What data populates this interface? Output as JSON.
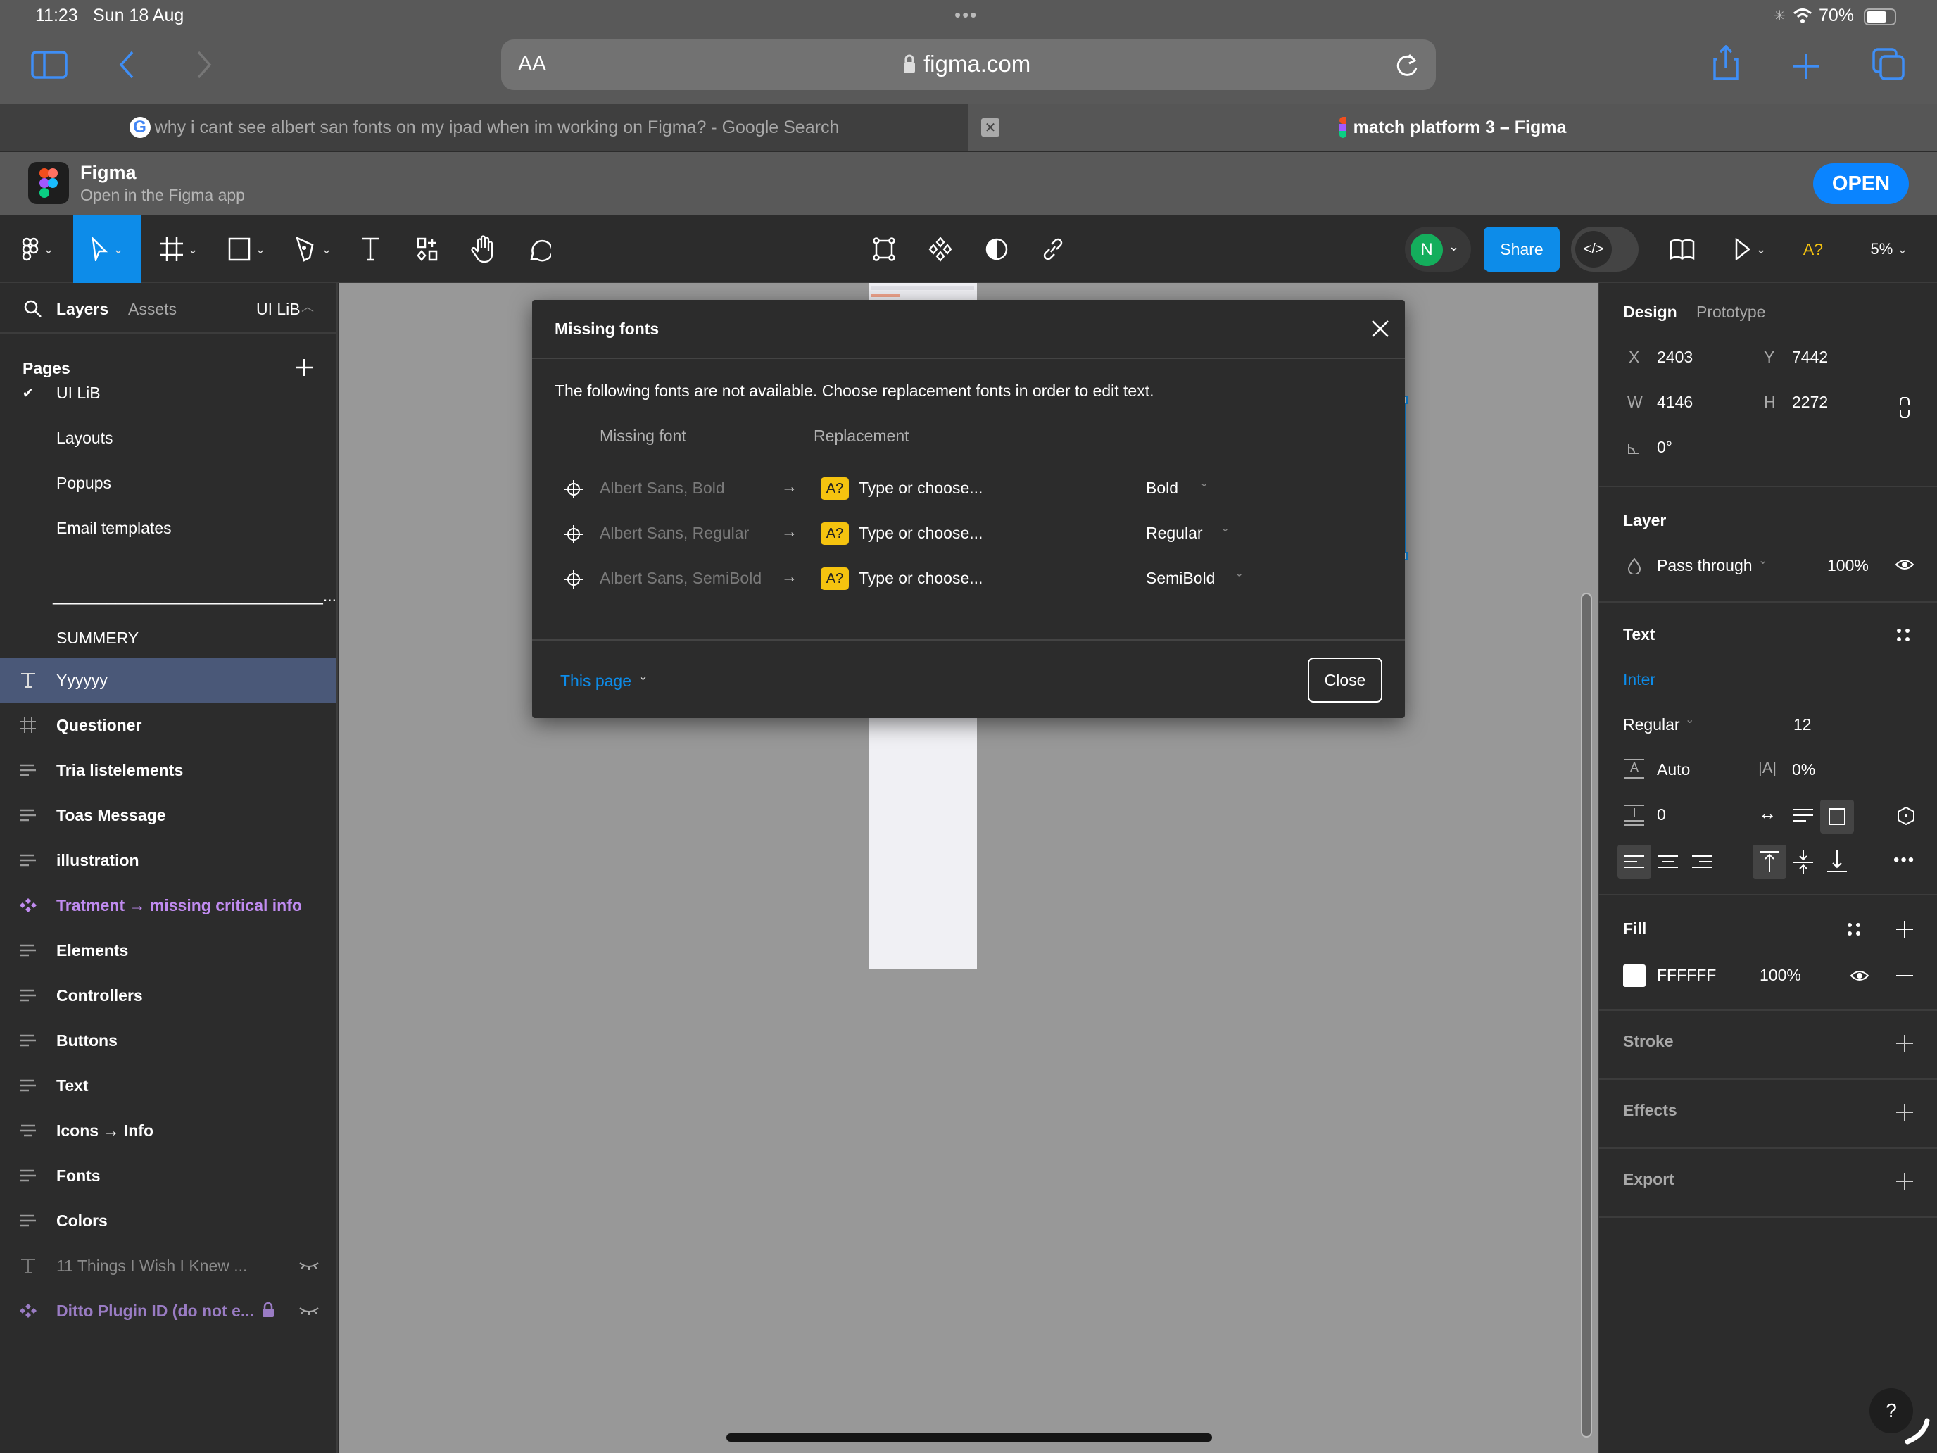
{
  "status_bar": {
    "time": "11:23",
    "date": "Sun 18 Aug",
    "battery": "70%"
  },
  "safari": {
    "reader_label": "AA",
    "url": "figma.com",
    "tabs": [
      {
        "title": "why i cant see albert san fonts on my ipad when im working on Figma? - Google Search",
        "active": false
      },
      {
        "title": "match platform 3 – Figma",
        "active": true
      }
    ],
    "banner": {
      "app_name": "Figma",
      "subtitle": "Open in the Figma app",
      "open_label": "OPEN"
    }
  },
  "toolbar": {
    "avatar_initial": "N",
    "share_label": "Share",
    "code_label": "</>",
    "missing_font_label": "A?",
    "zoom_level": "5%"
  },
  "left_panel": {
    "tabs": {
      "layers": "Layers",
      "assets": "Assets",
      "page_selector": "UI LiB"
    },
    "pages_heading": "Pages",
    "pages": [
      {
        "label": "UI LiB",
        "current": true
      },
      {
        "label": "Layouts"
      },
      {
        "label": "Popups"
      },
      {
        "label": "Email templates"
      },
      {
        "label": "______________________________..."
      },
      {
        "label": "SUMMERY"
      }
    ],
    "layers": [
      {
        "label": "Yyyyyy",
        "icon": "text",
        "selected": true
      },
      {
        "label": "Questioner",
        "icon": "frame"
      },
      {
        "label": "Tria listelements",
        "icon": "auto-layout"
      },
      {
        "label": "Toas Message",
        "icon": "auto-layout"
      },
      {
        "label": "illustration",
        "icon": "auto-layout"
      },
      {
        "label": "Tratment → missing critical info",
        "icon": "component"
      },
      {
        "label": "Elements",
        "icon": "auto-layout"
      },
      {
        "label": "Controllers",
        "icon": "auto-layout"
      },
      {
        "label": "Buttons",
        "icon": "auto-layout"
      },
      {
        "label": "Text",
        "icon": "auto-layout"
      },
      {
        "label": "Icons → Info",
        "icon": "auto-layout-center"
      },
      {
        "label": "Fonts",
        "icon": "auto-layout"
      },
      {
        "label": "Colors",
        "icon": "auto-layout"
      },
      {
        "label": "11 Things I Wish I Knew ...",
        "icon": "text",
        "hidden": true
      },
      {
        "label": "Ditto Plugin ID (do not e...",
        "icon": "component",
        "hidden": true,
        "locked": true
      }
    ]
  },
  "modal": {
    "title": "Missing fonts",
    "description": "The following fonts are not available. Choose replacement fonts in order to edit text.",
    "col_missing": "Missing font",
    "col_replacement": "Replacement",
    "rows": [
      {
        "missing": "Albert Sans, Bold",
        "placeholder": "Type or choose...",
        "style": "Bold"
      },
      {
        "missing": "Albert Sans, Regular",
        "placeholder": "Type or choose...",
        "style": "Regular"
      },
      {
        "missing": "Albert Sans, SemiBold",
        "placeholder": "Type or choose...",
        "style": "SemiBold"
      }
    ],
    "scope": "This page",
    "close_label": "Close"
  },
  "right_panel": {
    "tabs": {
      "design": "Design",
      "prototype": "Prototype"
    },
    "x_label": "X",
    "x": "2403",
    "y_label": "Y",
    "y": "7442",
    "w_label": "W",
    "w": "4146",
    "h_label": "H",
    "h": "2272",
    "rotation": "0°",
    "layer": {
      "heading": "Layer",
      "blend": "Pass through",
      "opacity": "100%"
    },
    "text": {
      "heading": "Text",
      "font": "Inter",
      "weight": "Regular",
      "size": "12",
      "line_height": "Auto",
      "letter_spacing": "0%",
      "paragraph_spacing": "0"
    },
    "fill": {
      "heading": "Fill",
      "hex": "FFFFFF",
      "opacity": "100%",
      "swatch": "#FFFFFF"
    },
    "stroke": {
      "heading": "Stroke"
    },
    "effects": {
      "heading": "Effects"
    },
    "export": {
      "heading": "Export"
    }
  },
  "help_label": "?",
  "colors": {
    "accent": "#0d8ce9",
    "component": "#c08bf0",
    "warning": "#f5c30f",
    "avatar": "#14ae5c"
  }
}
